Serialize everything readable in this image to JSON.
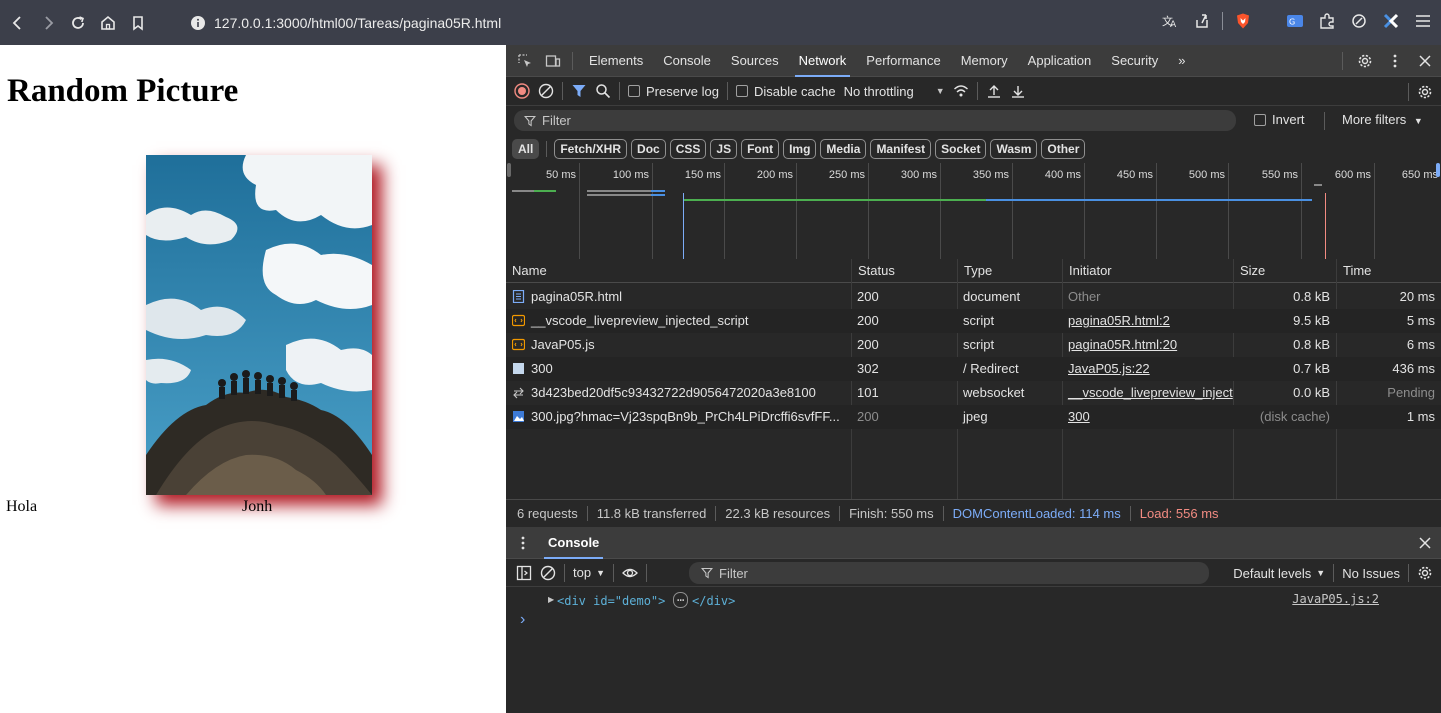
{
  "browser": {
    "url": "127.0.0.1:3000/html00/Tareas/pagina05R.html"
  },
  "page": {
    "heading": "Random Picture",
    "caption_left": "Hola",
    "caption_right": "Jonh"
  },
  "devtools": {
    "tabs": [
      "Elements",
      "Console",
      "Sources",
      "Network",
      "Performance",
      "Memory",
      "Application",
      "Security"
    ],
    "active_tab": "Network",
    "more_tabs": "»",
    "toolbar": {
      "preserve_log": "Preserve log",
      "disable_cache": "Disable cache",
      "throttling": "No throttling"
    },
    "filter": {
      "placeholder": "Filter",
      "invert": "Invert",
      "more_filters": "More filters"
    },
    "type_filters": [
      "All",
      "Fetch/XHR",
      "Doc",
      "CSS",
      "JS",
      "Font",
      "Img",
      "Media",
      "Manifest",
      "Socket",
      "Wasm",
      "Other"
    ],
    "overview_ticks": [
      "50 ms",
      "100 ms",
      "150 ms",
      "200 ms",
      "250 ms",
      "300 ms",
      "350 ms",
      "400 ms",
      "450 ms",
      "500 ms",
      "550 ms",
      "600 ms",
      "650 ms"
    ],
    "columns": [
      "Name",
      "Status",
      "Type",
      "Initiator",
      "Size",
      "Time"
    ],
    "requests": [
      {
        "name": "pagina05R.html",
        "status": "200",
        "type": "document",
        "initiator": "Other",
        "size": "0.8 kB",
        "time": "20 ms",
        "icon": "document-icon"
      },
      {
        "name": "__vscode_livepreview_injected_script",
        "status": "200",
        "type": "script",
        "initiator": "pagina05R.html:2",
        "size": "9.5 kB",
        "time": "5 ms",
        "icon": "script-icon"
      },
      {
        "name": "JavaP05.js",
        "status": "200",
        "type": "script",
        "initiator": "pagina05R.html:20",
        "size": "0.8 kB",
        "time": "6 ms",
        "icon": "script-icon"
      },
      {
        "name": "300",
        "status": "302",
        "type": "/ Redirect",
        "initiator": "JavaP05.js:22",
        "size": "0.7 kB",
        "time": "436 ms",
        "icon": "redirect-icon"
      },
      {
        "name": "3d423bed20df5c93432722d9056472020a3e8100",
        "status": "101",
        "type": "websocket",
        "initiator": "__vscode_livepreview_inject",
        "size": "0.0 kB",
        "time": "Pending",
        "icon": "websocket-icon"
      },
      {
        "name": "300.jpg?hmac=Vj23spqBn9b_PrCh4LPiDrcffi6svfFF...",
        "status": "200",
        "type": "jpeg",
        "initiator": "300",
        "size": "(disk cache)",
        "time": "1 ms",
        "icon": "image-icon"
      }
    ],
    "status": {
      "requests": "6 requests",
      "transferred": "11.8 kB transferred",
      "resources": "22.3 kB resources",
      "finish": "Finish: 550 ms",
      "dcl": "DOMContentLoaded: 114 ms",
      "load": "Load: 556 ms"
    },
    "console": {
      "tab": "Console",
      "context": "top",
      "filter_placeholder": "Filter",
      "levels": "Default levels",
      "issues": "No Issues",
      "log_line": "<div id=\"demo\">",
      "log_ellipsis": "⋯",
      "log_close": "</div>",
      "log_source": "JavaP05.js:2",
      "prompt": "›"
    }
  }
}
